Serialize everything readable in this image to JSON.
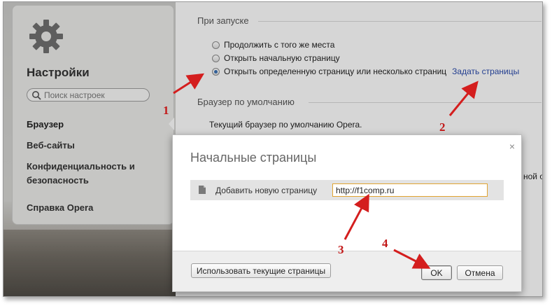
{
  "sidebar": {
    "title": "Настройки",
    "search_placeholder": "Поиск настроек",
    "items": [
      {
        "label": "Браузер"
      },
      {
        "label": "Веб-сайты"
      },
      {
        "label": "Конфиденциальность и"
      },
      {
        "label": "безопасность"
      },
      {
        "label": "Справка Opera"
      }
    ]
  },
  "startup": {
    "heading": "При запуске",
    "options": [
      {
        "label": "Продолжить с того же места",
        "selected": false
      },
      {
        "label": "Открыть начальную страницу",
        "selected": false
      },
      {
        "label": "Открыть определенную страницу или несколько страниц",
        "selected": true
      }
    ],
    "set_pages_link": "Задать страницы"
  },
  "default_browser": {
    "heading": "Браузер по умолчанию",
    "info": "Текущий браузер по умолчанию Opera.",
    "cut_text": "ной о"
  },
  "dialog": {
    "title": "Начальные страницы",
    "close": "×",
    "add_label": "Добавить новую страницу",
    "url_value": "http://f1comp.ru",
    "use_current_button": "Использовать текущие страницы",
    "ok_button": "OK",
    "cancel_button": "Отмена"
  },
  "annotations": {
    "n1": "1",
    "n2": "2",
    "n3": "3",
    "n4": "4",
    "color": "#d41e1e"
  }
}
